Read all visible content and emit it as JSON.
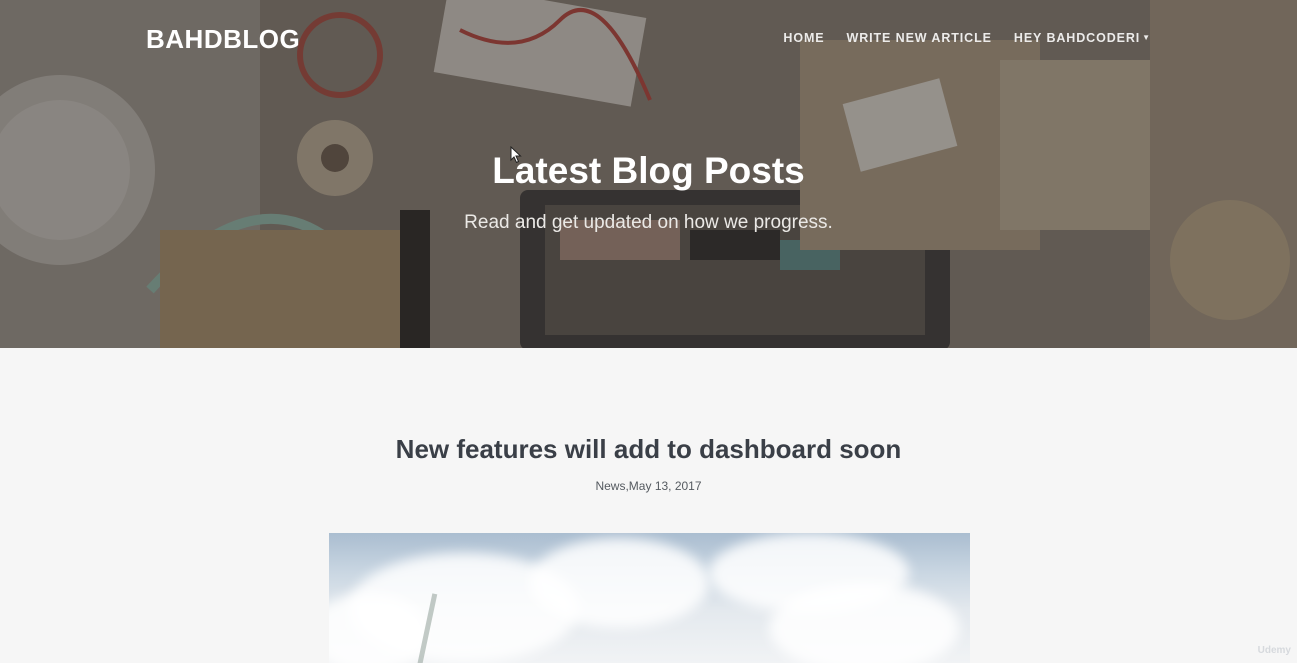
{
  "navbar": {
    "brand": "BAHDBLOG",
    "links": [
      {
        "label": "HOME"
      },
      {
        "label": "WRITE NEW ARTICLE"
      },
      {
        "label": "HEY BAHDCODERI"
      }
    ]
  },
  "hero": {
    "title": "Latest Blog Posts",
    "subtitle": "Read and get updated on how we progress."
  },
  "post": {
    "title": "New features will add to dashboard soon",
    "meta": "News,May 13, 2017"
  },
  "watermark": "Udemy",
  "colors": {
    "page_background": "#f6f6f6",
    "post_title": "#3a3f47",
    "hero_text": "#ffffff"
  }
}
